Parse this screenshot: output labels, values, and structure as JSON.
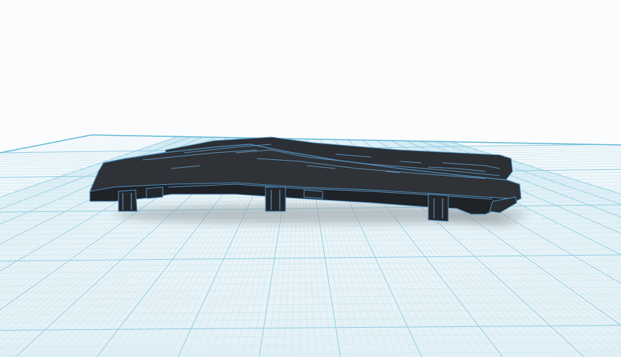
{
  "scene": {
    "background_color": "#fbfcfd",
    "grid_fill_color": "#e6f2f6",
    "grid_minor_line_color": "#c9e6f0",
    "grid_major_line_color": "#8fcde2",
    "grid_edge_color": "#62b8d8",
    "model_fill_color": "#2f3236",
    "model_dark_color": "#1f2226",
    "model_edge_color": "#4f8fc0",
    "shadow_color": "#9aa3a8"
  },
  "workplane": {
    "label": "workplane-grid"
  },
  "model": {
    "label": "3d-model-part"
  }
}
